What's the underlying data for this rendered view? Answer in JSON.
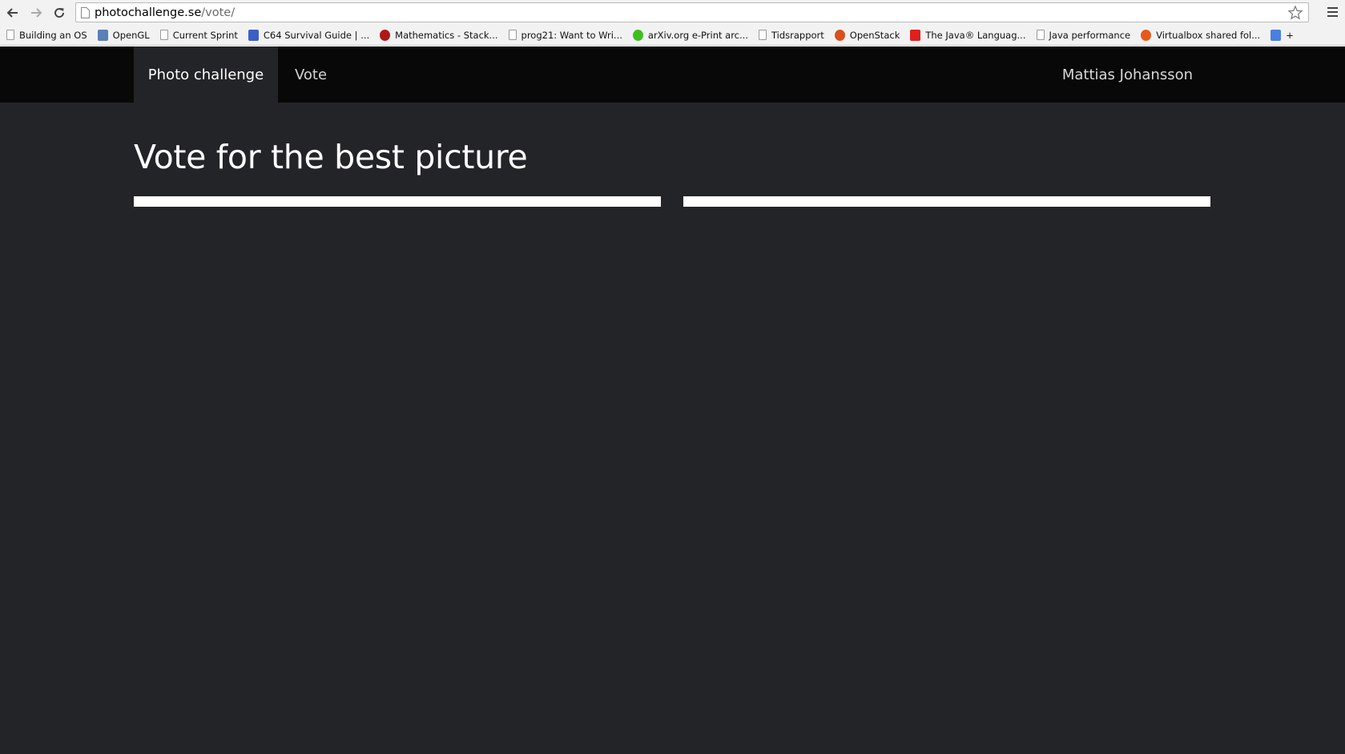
{
  "browser": {
    "url_host": "photochallenge.se",
    "url_path": "/vote/",
    "bookmarks": [
      {
        "label": "Building an OS",
        "icon": "page-icon",
        "color": "#ffffff"
      },
      {
        "label": "OpenGL",
        "icon": "opengl-icon",
        "color": "#5b7fb7"
      },
      {
        "label": "Current Sprint",
        "icon": "page-icon",
        "color": "#ffffff"
      },
      {
        "label": "C64 Survival Guide | ...",
        "icon": "c64-icon",
        "color": "#3b5fc4"
      },
      {
        "label": "Mathematics - Stack...",
        "icon": "stackexchange-math-icon",
        "color": "#b01818"
      },
      {
        "label": "prog21: Want to Wri...",
        "icon": "page-icon",
        "color": "#ffffff"
      },
      {
        "label": "arXiv.org e-Print arc...",
        "icon": "smiley-icon",
        "color": "#3fbf1f"
      },
      {
        "label": "Tidsrapport",
        "icon": "page-icon",
        "color": "#ffffff"
      },
      {
        "label": "OpenStack",
        "icon": "openstack-icon",
        "color": "#d9501e"
      },
      {
        "label": "The Java® Languag...",
        "icon": "oracle-icon",
        "color": "#e01f1f"
      },
      {
        "label": "Java performance",
        "icon": "page-icon",
        "color": "#ffffff"
      },
      {
        "label": "Virtualbox shared fol...",
        "icon": "ask-icon",
        "color": "#e8591c"
      },
      {
        "label": "+",
        "icon": "google-icon",
        "color": "#4a7fe0"
      }
    ]
  },
  "navbar": {
    "brand": "Photo challenge",
    "vote": "Vote",
    "user": "Mattias Johansson"
  },
  "main": {
    "title": "Vote for the best picture"
  },
  "colors": {
    "page_background": "#232427",
    "navbar_background": "#080808",
    "card": "#ffffff"
  }
}
